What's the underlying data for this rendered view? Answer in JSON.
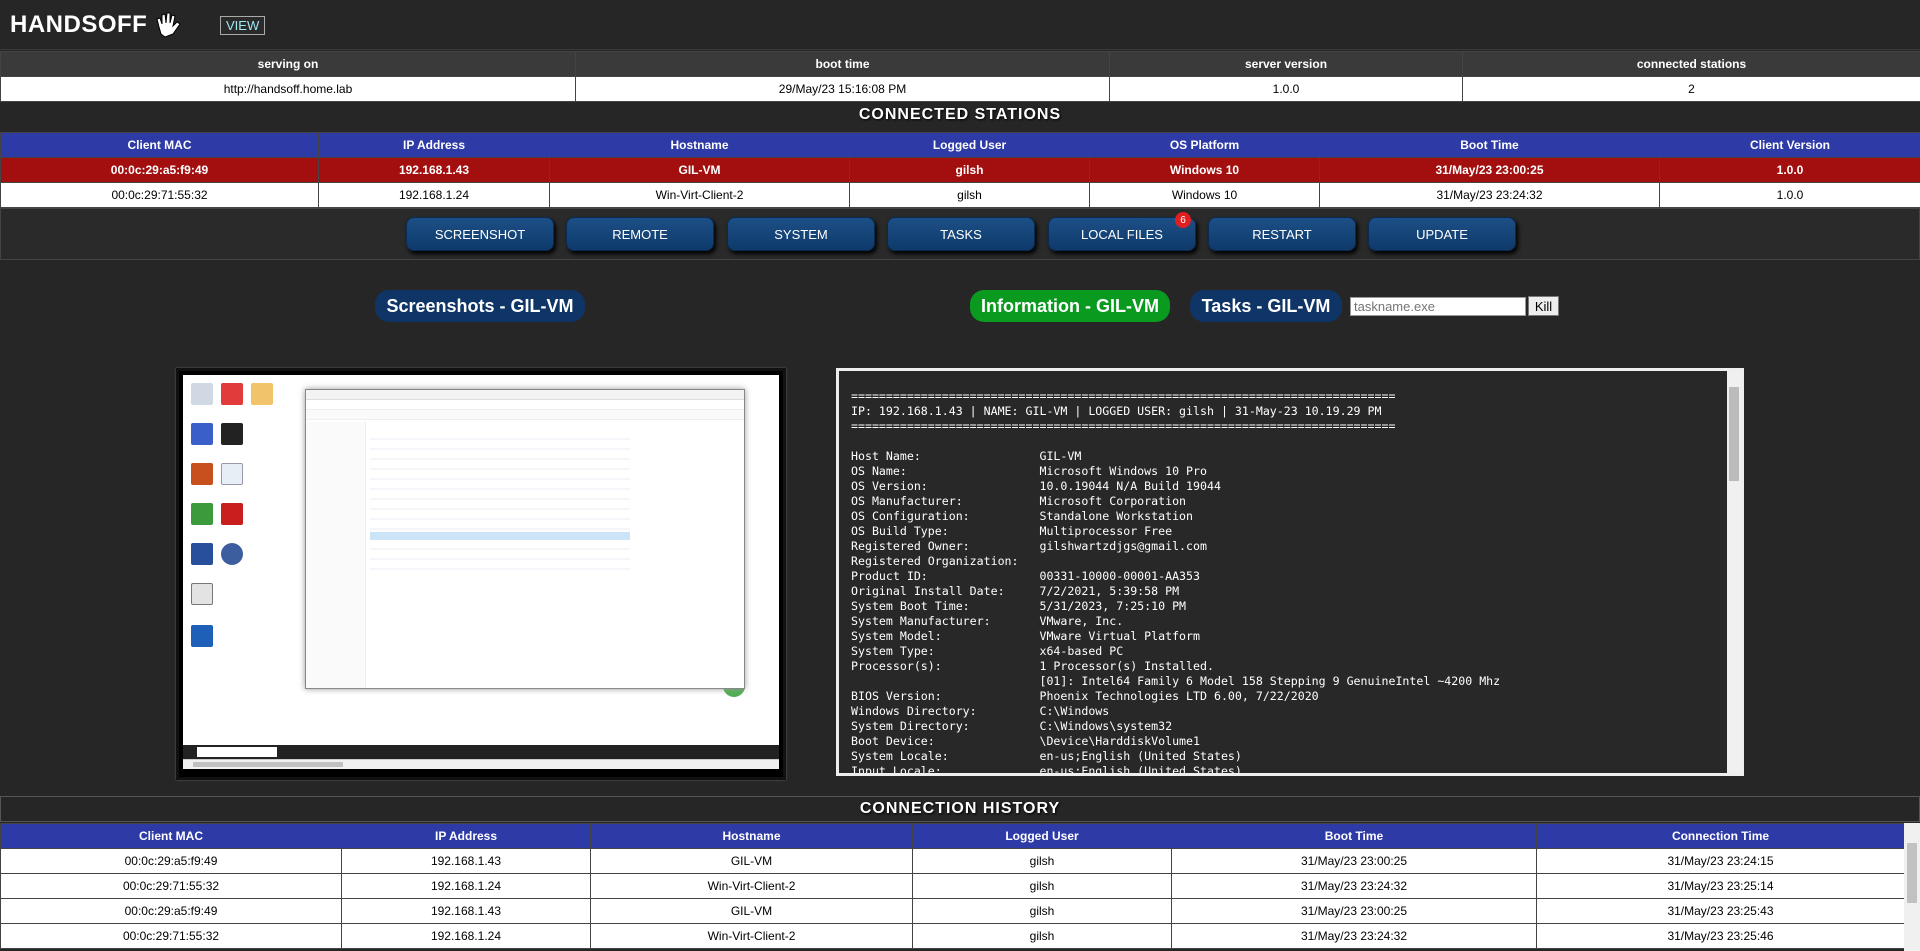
{
  "header": {
    "logo_text": "HANDSOFF",
    "view_label": "VIEW"
  },
  "server_info": {
    "headers": [
      "serving on",
      "boot time",
      "server version",
      "connected stations"
    ],
    "values": [
      "http://handsoff.home.lab",
      "29/May/23 15:16:08 PM",
      "1.0.0",
      "2"
    ]
  },
  "connected": {
    "title": "CONNECTED STATIONS",
    "headers": [
      "Client MAC",
      "IP Address",
      "Hostname",
      "Logged User",
      "OS Platform",
      "Boot Time",
      "Client Version"
    ],
    "rows": [
      [
        "00:0c:29:a5:f9:49",
        "192.168.1.43",
        "GIL-VM",
        "gilsh",
        "Windows 10",
        "31/May/23 23:00:25",
        "1.0.0"
      ],
      [
        "00:0c:29:71:55:32",
        "192.168.1.24",
        "Win-Virt-Client-2",
        "gilsh",
        "Windows 10",
        "31/May/23 23:24:32",
        "1.0.0"
      ]
    ]
  },
  "actions": {
    "screenshot": "SCREENSHOT",
    "remote": "REMOTE",
    "system": "SYSTEM",
    "tasks": "TASKS",
    "local_files": "LOCAL FILES",
    "local_files_badge": "6",
    "restart": "RESTART",
    "update": "UPDATE"
  },
  "panels": {
    "screenshots_title": "Screenshots - GIL-VM",
    "information_title": "Information - GIL-VM",
    "tasks_title": "Tasks - GIL-VM",
    "task_placeholder": "taskname.exe",
    "kill_label": "Kill"
  },
  "console_text": "==============================================================================\nIP: 192.168.1.43 | NAME: GIL-VM | LOGGED USER: gilsh | 31-May-23 10.19.29 PM\n==============================================================================\n\nHost Name:                 GIL-VM\nOS Name:                   Microsoft Windows 10 Pro\nOS Version:                10.0.19044 N/A Build 19044\nOS Manufacturer:           Microsoft Corporation\nOS Configuration:          Standalone Workstation\nOS Build Type:             Multiprocessor Free\nRegistered Owner:          gilshwartzdjgs@gmail.com\nRegistered Organization:\nProduct ID:                00331-10000-00001-AA353\nOriginal Install Date:     7/2/2021, 5:39:58 PM\nSystem Boot Time:          5/31/2023, 7:25:10 PM\nSystem Manufacturer:       VMware, Inc.\nSystem Model:              VMware Virtual Platform\nSystem Type:               x64-based PC\nProcessor(s):              1 Processor(s) Installed.\n                           [01]: Intel64 Family 6 Model 158 Stepping 9 GenuineIntel ~4200 Mhz\nBIOS Version:              Phoenix Technologies LTD 6.00, 7/22/2020\nWindows Directory:         C:\\Windows\nSystem Directory:          C:\\Windows\\system32\nBoot Device:               \\Device\\HarddiskVolume1\nSystem Locale:             en-us;English (United States)\nInput Locale:              en-us;English (United States)",
  "history": {
    "title": "CONNECTION HISTORY",
    "headers": [
      "Client MAC",
      "IP Address",
      "Hostname",
      "Logged User",
      "Boot Time",
      "Connection Time"
    ],
    "rows": [
      [
        "00:0c:29:a5:f9:49",
        "192.168.1.43",
        "GIL-VM",
        "gilsh",
        "31/May/23 23:00:25",
        "31/May/23 23:24:15"
      ],
      [
        "00:0c:29:71:55:32",
        "192.168.1.24",
        "Win-Virt-Client-2",
        "gilsh",
        "31/May/23 23:24:32",
        "31/May/23 23:25:14"
      ],
      [
        "00:0c:29:a5:f9:49",
        "192.168.1.43",
        "GIL-VM",
        "gilsh",
        "31/May/23 23:00:25",
        "31/May/23 23:25:43"
      ],
      [
        "00:0c:29:71:55:32",
        "192.168.1.24",
        "Win-Virt-Client-2",
        "gilsh",
        "31/May/23 23:24:32",
        "31/May/23 23:25:46"
      ]
    ]
  },
  "colors": {
    "accent_blue": "#2e3aa6",
    "selected_row": "#a30f0f",
    "info_green": "#0a9a1f",
    "button_blue": "#1d4f86",
    "badge_red": "#e02020"
  },
  "icons": [
    "hand-icon",
    "screenshot-thumbnail"
  ]
}
